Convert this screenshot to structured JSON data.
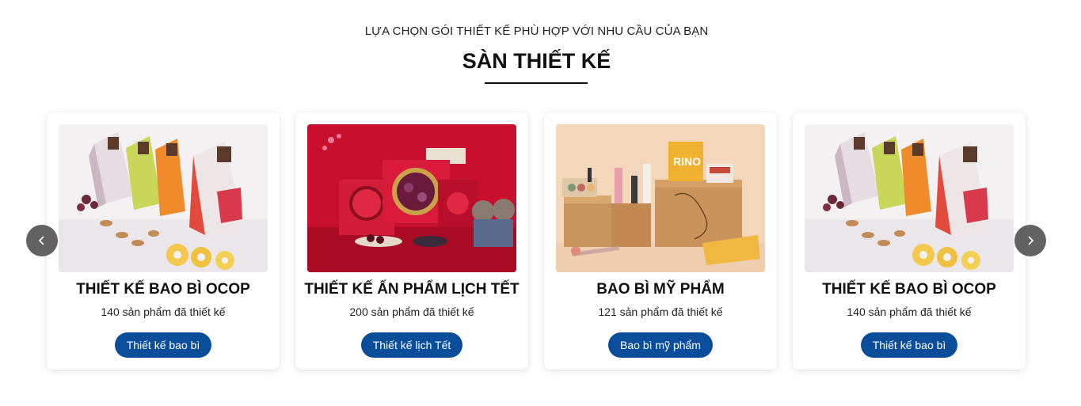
{
  "section": {
    "subtitle": "LỰA CHỌN GÓI THIẾT KẾ PHÙ HỢP VỚI NHU CẦU CỦA BẠN",
    "title": "SÀN THIẾT KẾ"
  },
  "carousel": {
    "prev_icon": "chevron-left-icon",
    "next_icon": "chevron-right-icon",
    "cards": [
      {
        "title": "THIẾT KẾ BAO BÌ OCOP",
        "count": "140 sản phẩm đã thiết kế",
        "button": "Thiết kế bao bì"
      },
      {
        "title": "THIẾT KẾ ẤN PHẨM LỊCH TẾT",
        "count": "200 sản phẩm đã thiết kế",
        "button": "Thiết kế lịch Tết"
      },
      {
        "title": "BAO BÌ MỸ PHẨM",
        "count": "121 sản phẩm đã thiết kế",
        "button": "Bao bì mỹ phẩm"
      },
      {
        "title": "THIẾT KẾ BAO BÌ OCOP",
        "count": "140 sản phẩm đã thiết kế",
        "button": "Thiết kế bao bì"
      }
    ]
  },
  "colors": {
    "button_bg": "#0a4e9b",
    "arrow_bg": "#464646"
  }
}
